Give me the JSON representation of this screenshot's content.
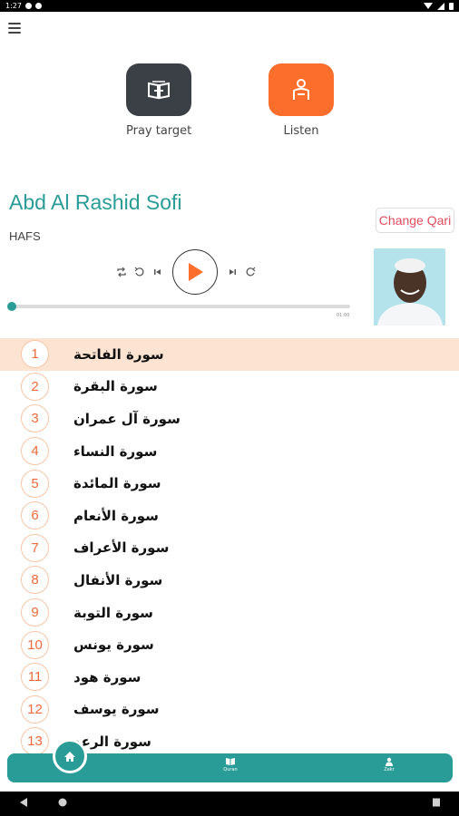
{
  "status_bar": {
    "time": "1:27"
  },
  "menu": {
    "icon": "hamburger-menu-icon"
  },
  "features": [
    {
      "label": "Pray target",
      "icon": "quran-book-icon",
      "color": "#3b3f46"
    },
    {
      "label": "Listen",
      "icon": "reader-listen-icon",
      "color": "#fb6e2c"
    }
  ],
  "player": {
    "qari_name": "Abd Al Rashid Sofi",
    "riwaya": "HAFS",
    "change_qari_label": "Change Qari",
    "progress_fraction": 0.0,
    "duration": "01:00",
    "controls": [
      "repeat-icon",
      "rewind-icon",
      "previous-icon",
      "play-icon",
      "next-icon",
      "forward-icon"
    ]
  },
  "surahs": [
    {
      "number": "1",
      "name": "سورة الفاتحة",
      "active": true
    },
    {
      "number": "2",
      "name": "سورة البقرة"
    },
    {
      "number": "3",
      "name": "سورة آل عمران"
    },
    {
      "number": "4",
      "name": "سورة النساء"
    },
    {
      "number": "5",
      "name": "سورة المائدة"
    },
    {
      "number": "6",
      "name": "سورة الأنعام"
    },
    {
      "number": "7",
      "name": "سورة الأعراف"
    },
    {
      "number": "8",
      "name": "سورة الأنفال"
    },
    {
      "number": "9",
      "name": "سورة التوبة"
    },
    {
      "number": "10",
      "name": "سورة يونس"
    },
    {
      "number": "11",
      "name": "سورة هود"
    },
    {
      "number": "12",
      "name": "سورة يوسف"
    },
    {
      "number": "13",
      "name": "سورة الرعد"
    }
  ],
  "bottom_nav": {
    "home_icon": "home-icon",
    "items": [
      {
        "label": "Quran",
        "icon": "quran-book-icon"
      },
      {
        "label": "Zekr",
        "icon": "person-icon"
      }
    ]
  },
  "colors": {
    "teal": "#2a9c98",
    "orange": "#fb6e2c",
    "highlight": "#fde3d2"
  }
}
